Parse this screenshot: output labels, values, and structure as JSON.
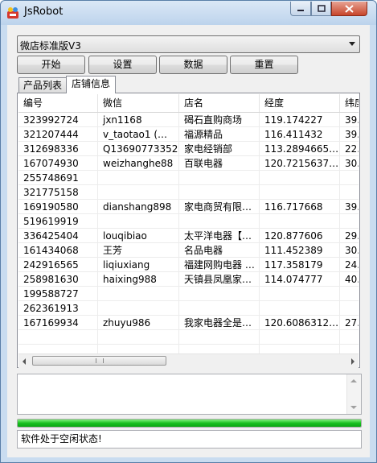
{
  "window": {
    "title": "JsRobot"
  },
  "version_select": {
    "value": "微店标准版V3"
  },
  "toolbar": {
    "start": "开始",
    "settings": "设置",
    "data": "数据",
    "reset": "重置"
  },
  "tabs": [
    {
      "label": "产品列表",
      "active": false
    },
    {
      "label": "店铺信息",
      "active": true
    }
  ],
  "table": {
    "columns": [
      "编号",
      "微信",
      "店名",
      "经度",
      "纬度"
    ],
    "rows": [
      [
        "323992724",
        "jxn1168",
        "碣石直购商场",
        "119.174227",
        "39."
      ],
      [
        "321207444",
        "v_taotao1 (…",
        "福源精品",
        "116.411432",
        "39."
      ],
      [
        "312698336",
        "Q13690773352",
        "家电经销部",
        "113.2894665…",
        "22."
      ],
      [
        "167074930",
        "weizhanghe88",
        "百联电器",
        "120.7215637…",
        "30."
      ],
      [
        "255748691",
        "",
        "",
        "",
        ""
      ],
      [
        "321775158",
        "",
        "",
        "",
        ""
      ],
      [
        "169190580",
        "dianshang898",
        "家电商贸有限…",
        "116.717668",
        "39."
      ],
      [
        "519619919",
        "",
        "",
        "",
        ""
      ],
      [
        "336425404",
        "louqibiao",
        "太平洋电器【…",
        "120.877606",
        "29."
      ],
      [
        "161434068",
        "王芳",
        "名品电器",
        "111.452389",
        "30."
      ],
      [
        "242916565",
        "liqiuxiang",
        "福建网购电器 …",
        "117.358179",
        "24."
      ],
      [
        "258981630",
        "haixing988",
        "天镇县凤凰家…",
        "114.074777",
        "40."
      ],
      [
        "199588727",
        "",
        "",
        "",
        ""
      ],
      [
        "262361913",
        "",
        "",
        "",
        ""
      ],
      [
        "167169934",
        "zhuyu986",
        "我家电器全是…",
        "120.6086312…",
        "27."
      ]
    ]
  },
  "log": {
    "text": ""
  },
  "progress": {
    "value": 1.0,
    "color": "#18c01f"
  },
  "status": {
    "text": "软件处于空闲状态!"
  }
}
